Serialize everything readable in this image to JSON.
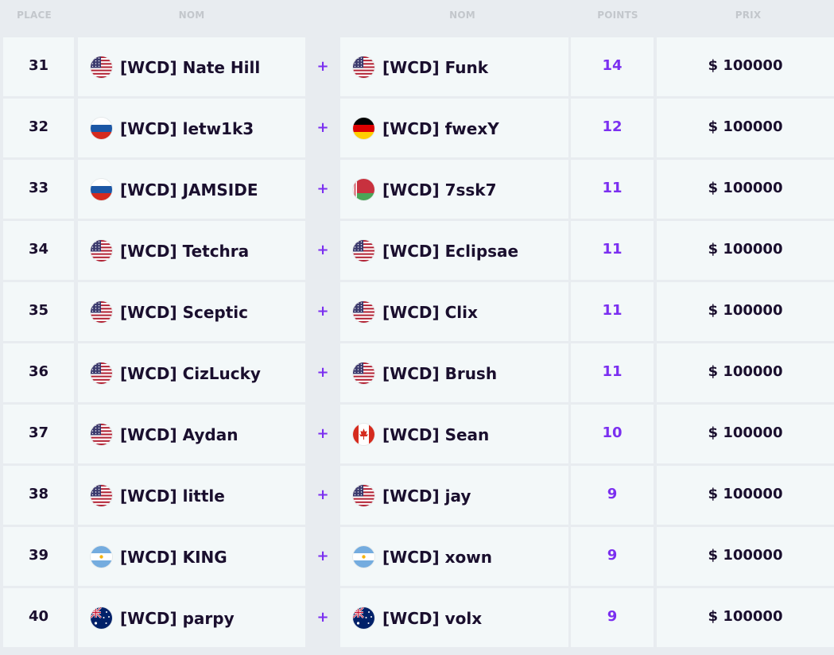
{
  "header": {
    "place": "PLACE",
    "name1": "NOM",
    "name2": "NOM",
    "points": "POINTS",
    "prize": "PRIX"
  },
  "colors": {
    "accent": "#7b2ff0",
    "row_bg": "#f3f8f9",
    "page_bg": "#e8ecf0",
    "text": "#1a0f2e"
  },
  "plus_symbol": "+",
  "rows": [
    {
      "place": "31",
      "p1": {
        "name": "[WCD] Nate Hill",
        "flag": "us"
      },
      "p2": {
        "name": "[WCD] Funk",
        "flag": "us"
      },
      "points": "14",
      "prize": "$ 100000"
    },
    {
      "place": "32",
      "p1": {
        "name": "[WCD] letw1k3",
        "flag": "ru"
      },
      "p2": {
        "name": "[WCD] fwexY",
        "flag": "de"
      },
      "points": "12",
      "prize": "$ 100000"
    },
    {
      "place": "33",
      "p1": {
        "name": "[WCD] JAMSIDE",
        "flag": "ru"
      },
      "p2": {
        "name": "[WCD] 7ssk7",
        "flag": "by"
      },
      "points": "11",
      "prize": "$ 100000"
    },
    {
      "place": "34",
      "p1": {
        "name": "[WCD] Tetchra",
        "flag": "us"
      },
      "p2": {
        "name": "[WCD] Eclipsae",
        "flag": "us"
      },
      "points": "11",
      "prize": "$ 100000"
    },
    {
      "place": "35",
      "p1": {
        "name": "[WCD] Sceptic",
        "flag": "us"
      },
      "p2": {
        "name": "[WCD] Clix",
        "flag": "us"
      },
      "points": "11",
      "prize": "$ 100000"
    },
    {
      "place": "36",
      "p1": {
        "name": "[WCD] CizLucky",
        "flag": "us"
      },
      "p2": {
        "name": "[WCD] Brush",
        "flag": "us"
      },
      "points": "11",
      "prize": "$ 100000"
    },
    {
      "place": "37",
      "p1": {
        "name": "[WCD] Aydan",
        "flag": "us"
      },
      "p2": {
        "name": "[WCD] Sean",
        "flag": "ca"
      },
      "points": "10",
      "prize": "$ 100000"
    },
    {
      "place": "38",
      "p1": {
        "name": "[WCD] little",
        "flag": "us"
      },
      "p2": {
        "name": "[WCD] jay",
        "flag": "us"
      },
      "points": "9",
      "prize": "$ 100000"
    },
    {
      "place": "39",
      "p1": {
        "name": "[WCD] KING",
        "flag": "ar"
      },
      "p2": {
        "name": "[WCD] xown",
        "flag": "ar"
      },
      "points": "9",
      "prize": "$ 100000"
    },
    {
      "place": "40",
      "p1": {
        "name": "[WCD] parpy",
        "flag": "au"
      },
      "p2": {
        "name": "[WCD] volx",
        "flag": "au"
      },
      "points": "9",
      "prize": "$ 100000"
    }
  ]
}
